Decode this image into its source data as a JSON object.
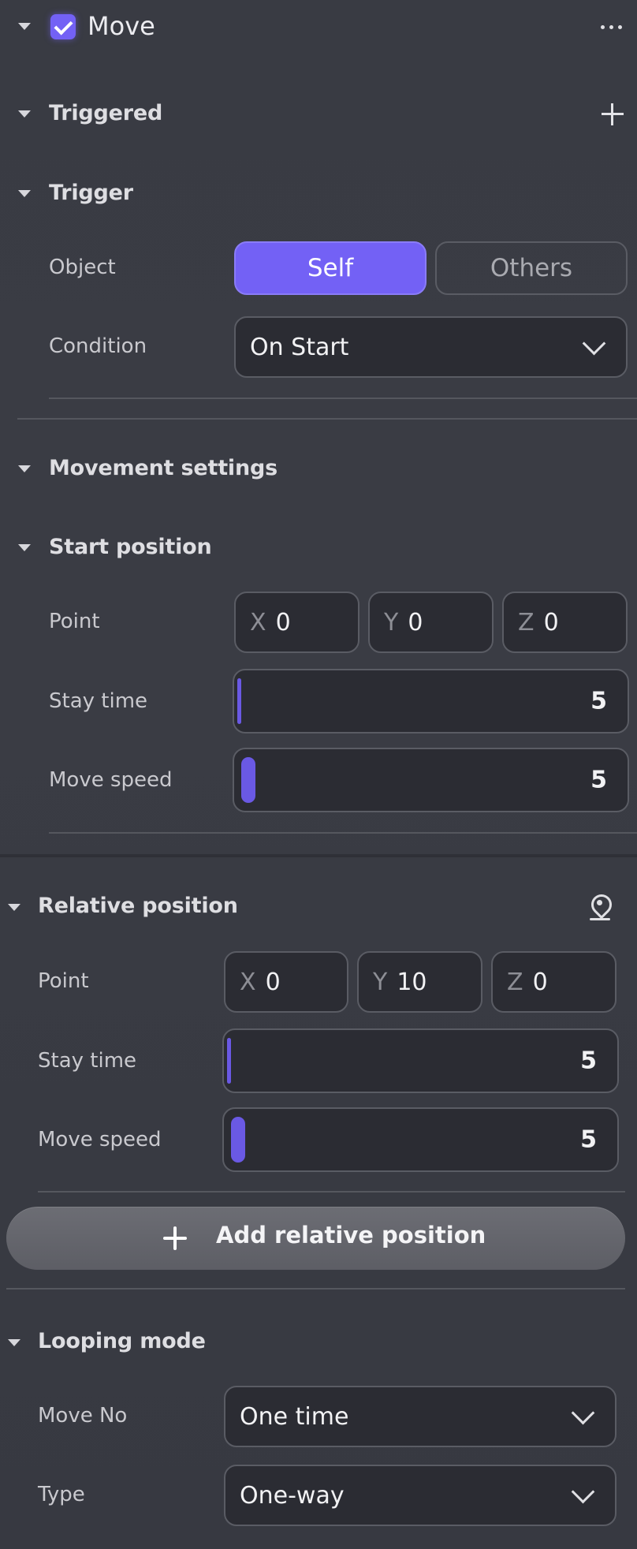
{
  "component": {
    "title": "Move",
    "enabled": true,
    "more_label": "⋯"
  },
  "triggered": {
    "title": "Triggered",
    "add_label": "+"
  },
  "trigger": {
    "title": "Trigger",
    "object_label": "Object",
    "object_options": [
      "Self",
      "Others"
    ],
    "object_selected": "Self",
    "condition_label": "Condition",
    "condition_value": "On Start"
  },
  "movement": {
    "title": "Movement settings"
  },
  "start_position": {
    "title": "Start position",
    "point_label": "Point",
    "x_axis": "X",
    "x": "0",
    "y_axis": "Y",
    "y": "0",
    "z_axis": "Z",
    "z": "0",
    "stay_label": "Stay time",
    "stay_value": "5",
    "speed_label": "Move speed",
    "speed_value": "5"
  },
  "relative_position": {
    "title": "Relative position",
    "point_label": "Point",
    "x_axis": "X",
    "x": "0",
    "y_axis": "Y",
    "y": "10",
    "z_axis": "Z",
    "z": "0",
    "stay_label": "Stay time",
    "stay_value": "5",
    "speed_label": "Move speed",
    "speed_value": "5"
  },
  "add_relative": {
    "label": "Add relative position",
    "icon": "+"
  },
  "looping": {
    "title": "Looping mode",
    "move_no_label": "Move No",
    "move_no_value": "One time",
    "type_label": "Type",
    "type_value": "One-way"
  },
  "colors": {
    "accent": "#7361f5",
    "background": "#393b43",
    "field": "#2b2c33"
  }
}
